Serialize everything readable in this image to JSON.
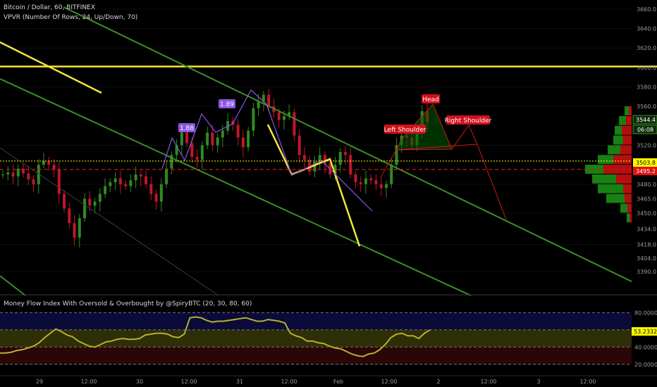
{
  "header": {
    "symbol_line": "Bitcoin / Dollar, 60, BITFINEX",
    "indicator_line": "VPVR (Number Of Rows, 24, Up/Down, 70)"
  },
  "mfi_title": "Money Flow Index With Oversold & Overbought by @SpiryBTC (20, 30, 80, 60)",
  "colors": {
    "background": "#000000",
    "bull": "#2e8b1f",
    "bear": "#c0162a",
    "trend_green": "#3a8f26",
    "yellow": "#f5e63a",
    "purple": "#8a55e0",
    "red_line": "#d01818",
    "mfi_line": "#b8b12e",
    "price_bubble_yellow": "#ffff00",
    "price_bubble_red": "#e01010"
  },
  "price_axis": {
    "ticks": [
      "3660.0",
      "3640.0",
      "3620.0",
      "3600.0",
      "3580.0",
      "3560.0",
      "3544.4",
      "3520.0",
      "3503.8",
      "3495.2",
      "3480.0",
      "3465.0",
      "3450.0",
      "3434.0",
      "3418.0",
      "3404.0",
      "3390.0"
    ],
    "current_price": "3544.4",
    "countdown": "06:08",
    "yellow_level": "3503.8",
    "red_level": "3495.2"
  },
  "mfi_axis": {
    "ticks": [
      "80.0000",
      "60.0000",
      "40.0000",
      "20.0000"
    ],
    "current_value": "53.2332"
  },
  "time_axis": {
    "ticks": [
      "29",
      "12:00",
      "30",
      "12:00",
      "31",
      "12:00",
      "Feb",
      "12:00",
      "2",
      "12:00",
      "3",
      "12:00"
    ]
  },
  "annotations": {
    "fib_1": "1.88",
    "fib_2": "1.89",
    "head": "Head",
    "left_shoulder": "Left Shoulder",
    "right_shoulder": "Right Shoulder"
  },
  "chart_data": [
    {
      "type": "candlestick",
      "title": "Bitcoin / Dollar, 60, BITFINEX",
      "x": [],
      "ylim": [
        3380,
        3665
      ],
      "levels": [
        {
          "name": "horizontal resistance",
          "value": 3601,
          "color": "#f5e63a"
        },
        {
          "name": "dotted level",
          "value": 3503.8,
          "color": "#ffff00"
        },
        {
          "name": "dashed level",
          "value": 3495.2,
          "color": "#d01818"
        }
      ],
      "close_path": [
        3490,
        3492,
        3488,
        3496,
        3491,
        3485,
        3480,
        3500,
        3504,
        3500,
        3495,
        3470,
        3455,
        3440,
        3425,
        3445,
        3465,
        3458,
        3462,
        3470,
        3478,
        3482,
        3486,
        3480,
        3478,
        3484,
        3490,
        3488,
        3480,
        3470,
        3462,
        3480,
        3496,
        3510,
        3520,
        3533,
        3522,
        3508,
        3505,
        3520,
        3533,
        3520,
        3528,
        3535,
        3545,
        3541,
        3528,
        3518,
        3535,
        3558,
        3565,
        3572,
        3560,
        3554,
        3546,
        3550,
        3554,
        3530,
        3510,
        3505,
        3493,
        3503,
        3510,
        3501,
        3490,
        3500,
        3513,
        3510,
        3490,
        3482,
        3480,
        3486,
        3484,
        3480,
        3476,
        3480,
        3500,
        3520,
        3530,
        3528,
        3520,
        3535,
        3555,
        3544
      ],
      "volume_profile": [
        {
          "price": 3555,
          "up": 6,
          "down": 4
        },
        {
          "price": 3545,
          "up": 10,
          "down": 8
        },
        {
          "price": 3535,
          "up": 10,
          "down": 14
        },
        {
          "price": 3525,
          "up": 14,
          "down": 12
        },
        {
          "price": 3515,
          "up": 18,
          "down": 16
        },
        {
          "price": 3505,
          "up": 22,
          "down": 26
        },
        {
          "price": 3495,
          "up": 26,
          "down": 40
        },
        {
          "price": 3485,
          "up": 34,
          "down": 22
        },
        {
          "price": 3475,
          "up": 36,
          "down": 12
        },
        {
          "price": 3465,
          "up": 26,
          "down": 10
        },
        {
          "price": 3455,
          "up": 10,
          "down": 6
        },
        {
          "price": 3445,
          "up": 4,
          "down": 3
        }
      ]
    },
    {
      "type": "line",
      "title": "Money Flow Index With Oversold & Overbought by @SpiryBTC (20, 30, 80, 60)",
      "ylim": [
        10,
        90
      ],
      "levels": [
        80,
        60,
        40,
        20
      ],
      "series": [
        {
          "values": [
            33,
            33,
            34,
            36,
            37,
            39,
            41,
            45,
            51,
            56,
            61,
            58,
            54,
            52,
            47,
            44,
            41,
            40,
            43,
            46,
            47,
            49,
            50,
            49,
            49,
            50,
            54,
            55,
            56,
            56,
            55,
            52,
            51,
            55,
            74,
            75,
            74,
            71,
            69,
            70,
            70,
            71,
            72,
            73,
            74,
            72,
            70,
            70,
            72,
            71,
            70,
            68,
            56,
            53,
            51,
            47,
            47,
            45,
            44,
            41,
            39,
            38,
            35,
            32,
            30,
            29,
            32,
            33,
            37,
            43,
            51,
            55,
            56,
            53,
            53,
            50,
            56,
            60
          ]
        }
      ]
    }
  ]
}
